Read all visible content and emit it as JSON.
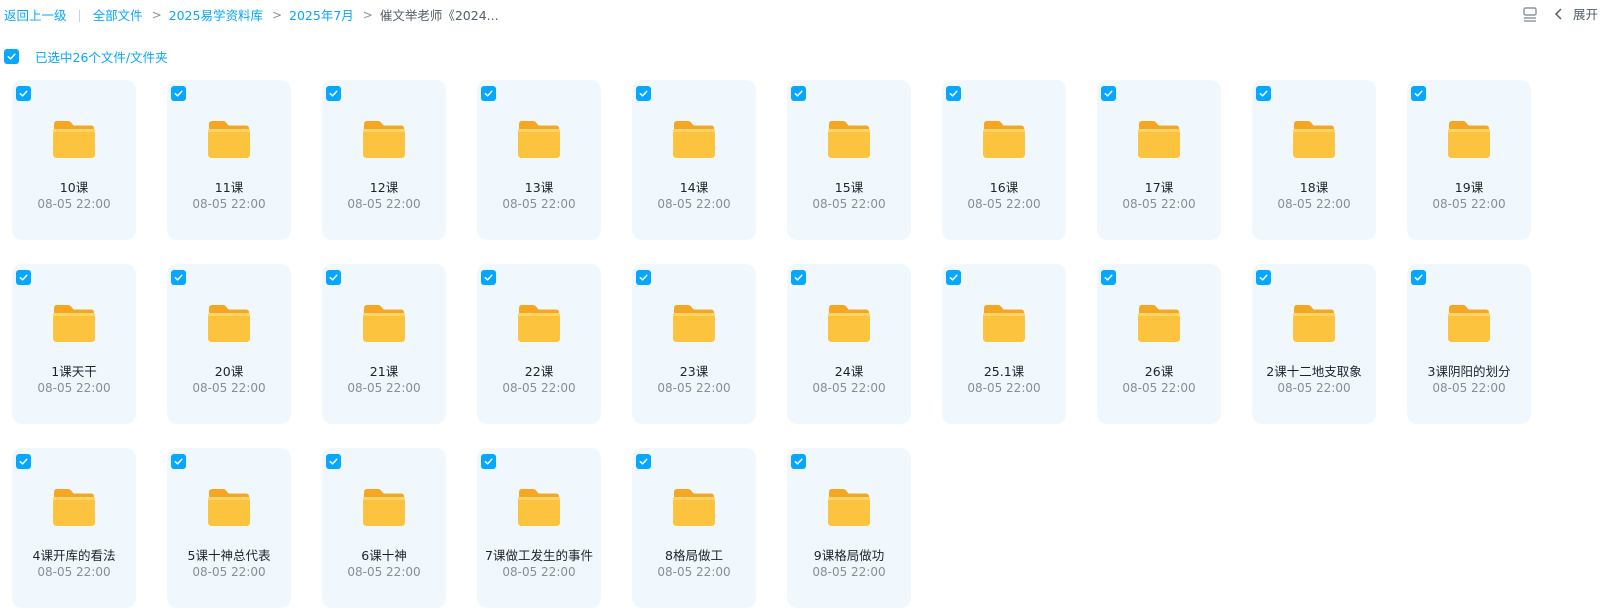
{
  "breadcrumb": {
    "back_label": "返回上一级",
    "items": [
      {
        "label": "全部文件"
      },
      {
        "label": "2025易学资料库"
      },
      {
        "label": "2025年7月"
      },
      {
        "label": "催文举老师《2024..."
      }
    ]
  },
  "toolbar": {
    "expand_label": "展开"
  },
  "selection": {
    "label": "已选中26个文件/文件夹",
    "checked": true
  },
  "colors": {
    "accent": "#06a7ff",
    "tile_bg": "#f1f8fd",
    "folder_yellow": "#fcc43e"
  },
  "icons": {
    "list_view": "list-view-icon",
    "collapse": "chevron-left-icon",
    "folder": "folder-icon",
    "checkbox": "checkbox-checked-icon"
  },
  "files": [
    {
      "name": "10课",
      "time": "08-05 22:00",
      "checked": true
    },
    {
      "name": "11课",
      "time": "08-05 22:00",
      "checked": true
    },
    {
      "name": "12课",
      "time": "08-05 22:00",
      "checked": true
    },
    {
      "name": "13课",
      "time": "08-05 22:00",
      "checked": true
    },
    {
      "name": "14课",
      "time": "08-05 22:00",
      "checked": true
    },
    {
      "name": "15课",
      "time": "08-05 22:00",
      "checked": true
    },
    {
      "name": "16课",
      "time": "08-05 22:00",
      "checked": true
    },
    {
      "name": "17课",
      "time": "08-05 22:00",
      "checked": true
    },
    {
      "name": "18课",
      "time": "08-05 22:00",
      "checked": true
    },
    {
      "name": "19课",
      "time": "08-05 22:00",
      "checked": true
    },
    {
      "name": "1课天干",
      "time": "08-05 22:00",
      "checked": true
    },
    {
      "name": "20课",
      "time": "08-05 22:00",
      "checked": true
    },
    {
      "name": "21课",
      "time": "08-05 22:00",
      "checked": true
    },
    {
      "name": "22课",
      "time": "08-05 22:00",
      "checked": true
    },
    {
      "name": "23课",
      "time": "08-05 22:00",
      "checked": true
    },
    {
      "name": "24课",
      "time": "08-05 22:00",
      "checked": true
    },
    {
      "name": "25.1课",
      "time": "08-05 22:00",
      "checked": true
    },
    {
      "name": "26课",
      "time": "08-05 22:00",
      "checked": true
    },
    {
      "name": "2课十二地支取象",
      "time": "08-05 22:00",
      "checked": true
    },
    {
      "name": "3课阴阳的划分",
      "time": "08-05 22:00",
      "checked": true
    },
    {
      "name": "4课开库的看法",
      "time": "08-05 22:00",
      "checked": true
    },
    {
      "name": "5课十神总代表",
      "time": "08-05 22:00",
      "checked": true
    },
    {
      "name": "6课十神",
      "time": "08-05 22:00",
      "checked": true
    },
    {
      "name": "7课做工发生的事件",
      "time": "08-05 22:00",
      "checked": true
    },
    {
      "name": "8格局做工",
      "time": "08-05 22:00",
      "checked": true
    },
    {
      "name": "9课格局做功",
      "time": "08-05 22:00",
      "checked": true
    }
  ]
}
